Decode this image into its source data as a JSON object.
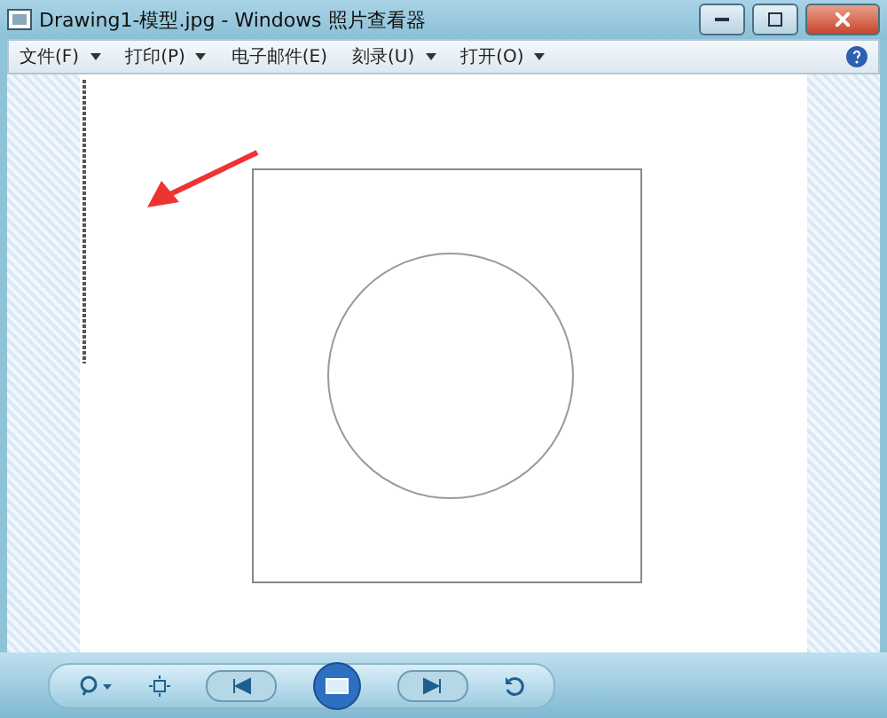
{
  "window": {
    "title": "Drawing1-模型.jpg - Windows 照片查看器"
  },
  "menu": [
    {
      "label": "文件(F)",
      "dropdown": true
    },
    {
      "label": "打印(P)",
      "dropdown": true
    },
    {
      "label": "电子邮件(E)",
      "dropdown": false
    },
    {
      "label": "刻录(U)",
      "dropdown": true
    },
    {
      "label": "打开(O)",
      "dropdown": true
    }
  ]
}
